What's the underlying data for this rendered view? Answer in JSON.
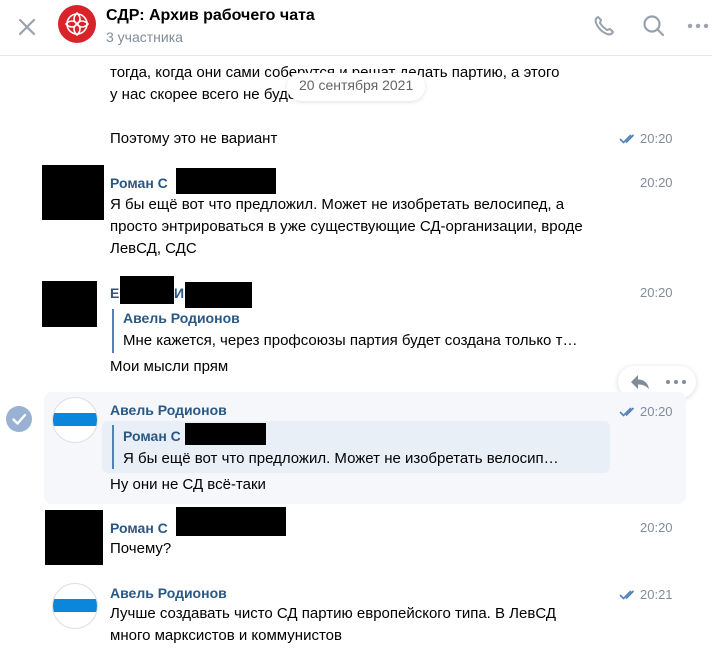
{
  "header": {
    "title": "СДР: Архив рабочего чата",
    "subtitle": "3 участника",
    "icons": [
      "close-icon",
      "phone-icon",
      "search-icon",
      "more-icon"
    ]
  },
  "date_separator": "20 сентября 2021",
  "messages": [
    {
      "lines": [
        "тогда, когда они сами соберутся и решат делать партию, а этого",
        "у нас скорее всего не будет"
      ]
    },
    {
      "text": "Поэтому это не вариант",
      "time": "20:20",
      "read": true
    },
    {
      "author": "Роман С",
      "time": "20:20",
      "lines": [
        "Я бы ещё вот что предложил. Может не изобретать велосипед, а",
        "просто энтрироваться в уже существующие СД-организации, вроде",
        "ЛевСД, СДС"
      ]
    },
    {
      "author_parts": [
        "Е",
        "И"
      ],
      "time": "20:20",
      "quote": {
        "author": "Авель Родионов",
        "text": "Мне кажется, через профсоюзы партия будет создана только т…"
      },
      "text": "Мои мысли прям"
    },
    {
      "author": "Авель Родионов",
      "time": "20:20",
      "read": true,
      "selected": true,
      "quote": {
        "author": "Роман С",
        "text": "Я бы ещё вот что предложил. Может не изобретать велосип…"
      },
      "text": "Ну они не СД всё-таки"
    },
    {
      "author": "Роман С",
      "time": "20:20",
      "text": "Почему?"
    },
    {
      "author": "Авель Родионов",
      "time": "20:21",
      "read": true,
      "lines": [
        "Лучше создавать чисто СД партию европейского типа. В ЛевСД",
        "много марксистов и коммунистов"
      ]
    }
  ],
  "message_actions": [
    "reply-icon",
    "more-icon"
  ],
  "colors": {
    "accent": "#2a5885",
    "link_blue": "#5181b8",
    "muted": "#818c99",
    "brand_red": "#d8232a",
    "stripe_blue": "#0a86db",
    "selected_bg": "#f5f7fa",
    "quote_bg": "#e9eff7"
  }
}
